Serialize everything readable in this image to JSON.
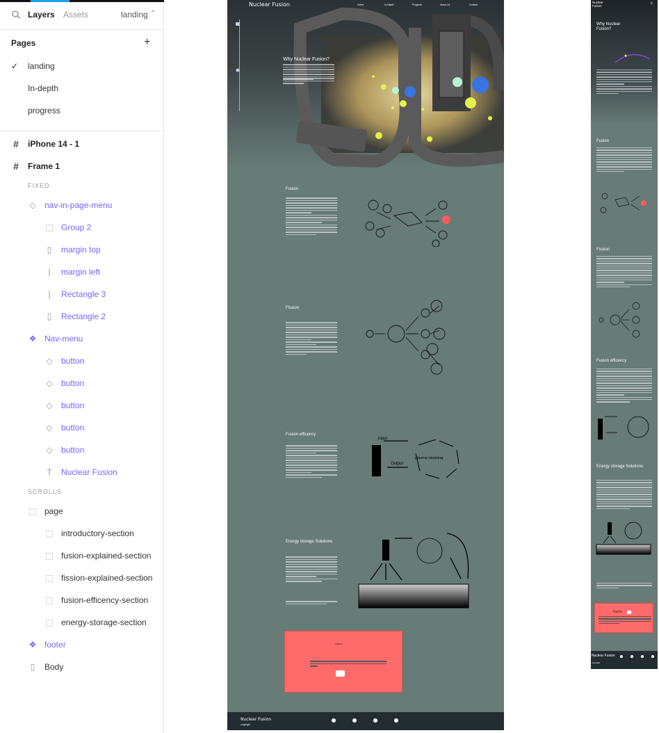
{
  "layers_panel": {
    "tab_layers": "Layers",
    "tab_assets": "Assets",
    "current_page": "landing",
    "pages_title": "Pages",
    "pages": [
      "landing",
      "In-depth",
      "progress"
    ],
    "frames": [
      {
        "label": "iPhone 14 - 1"
      },
      {
        "label": "Frame 1"
      }
    ],
    "fixed_header": "FIXED",
    "scrolls_header": "SCROLLS",
    "layers": [
      {
        "label": "nav-in-page-menu",
        "icon": "component-instance-icon"
      },
      {
        "label": "Group 2",
        "icon": "group-icon"
      },
      {
        "label": "margin top",
        "icon": "rectangle-icon"
      },
      {
        "label": "margin left",
        "icon": "line-icon"
      },
      {
        "label": "Rectangle 3",
        "icon": "line-icon"
      },
      {
        "label": "Rectangle 2",
        "icon": "rectangle-icon"
      },
      {
        "label": "Nav-menu",
        "icon": "component-icon"
      },
      {
        "label": "button",
        "icon": "component-instance-icon"
      },
      {
        "label": "button",
        "icon": "component-instance-icon"
      },
      {
        "label": "button",
        "icon": "component-instance-icon"
      },
      {
        "label": "button",
        "icon": "component-instance-icon"
      },
      {
        "label": "button",
        "icon": "component-instance-icon"
      },
      {
        "label": "Nuclear Fusion",
        "icon": "text-icon"
      },
      {
        "label": "page",
        "icon": "group-icon"
      },
      {
        "label": "introductory-section",
        "icon": "group-icon"
      },
      {
        "label": "fusion-explained-section",
        "icon": "group-icon"
      },
      {
        "label": "fission-explained-section",
        "icon": "group-icon"
      },
      {
        "label": "fusion-efficency-section",
        "icon": "group-icon"
      },
      {
        "label": "energy-storage-section",
        "icon": "group-icon"
      },
      {
        "label": "footer",
        "icon": "component-icon"
      },
      {
        "label": "Body",
        "icon": "rectangle-icon"
      }
    ]
  },
  "desktop": {
    "brand": "Nuclear Fusion",
    "nav": [
      "Home",
      "In-Depth",
      "Progress",
      "About Us",
      "Contact"
    ],
    "hero_title": "Why Nuclear Fusion?",
    "sections": [
      {
        "title": "Fusion"
      },
      {
        "title": "Fission"
      },
      {
        "title": "Fusion efficency"
      },
      {
        "title": "Energy storage Solutions"
      }
    ],
    "diagram_labels": {
      "input": "input",
      "output": "Output",
      "plasma": "plasma retaining"
    },
    "card_title": "Name",
    "footer_brand": "Nuclear Fusion",
    "footer_copy": "copyright"
  },
  "mobile": {
    "brand": "Nuclear Fusion",
    "hero_title": "Why Nuclear Fusion?",
    "sections": [
      "Fusion",
      "Fission",
      "Fusion efficency",
      "Energy storage Solutions"
    ],
    "card_title": "Name",
    "footer_brand": "Nuclear Fusion",
    "footer_copy": "copyright"
  },
  "colors": {
    "accent": "#7b61ff",
    "canvas_bg": "#677b77",
    "card": "#ff6b6b",
    "footer": "#232c30"
  }
}
